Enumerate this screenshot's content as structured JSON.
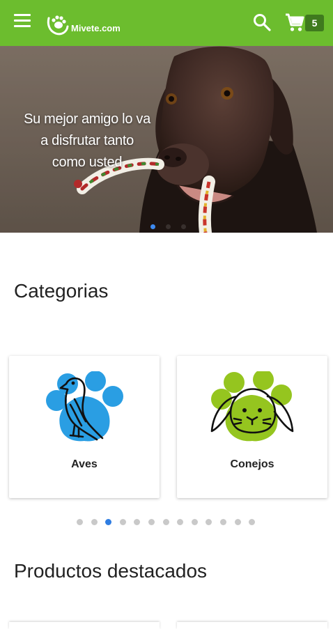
{
  "app_bar": {
    "logo_text": "Mivete.com",
    "cart_count": "5",
    "background_color": "#6cbd2e"
  },
  "hero": {
    "caption_line1": "Su mejor amigo lo va",
    "caption_line2": "a disfrutar tanto",
    "caption_line3": "como usted",
    "active_slide": 1,
    "slide_count": 3
  },
  "categories": {
    "title": "Categorias",
    "items": [
      {
        "label": "Aves",
        "icon": "bird-icon",
        "color": "#2a9ee3"
      },
      {
        "label": "Conejos",
        "icon": "rabbit-icon",
        "color": "#95c51f"
      }
    ],
    "pager_count": 13,
    "pager_active": 3
  },
  "featured": {
    "title": "Productos destacados"
  },
  "colors": {
    "accent": "#6cbd2e",
    "dot_active": "#2f7de1",
    "dot_inactive": "#c9c9c9"
  }
}
